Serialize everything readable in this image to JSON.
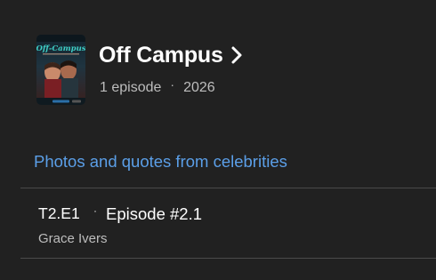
{
  "show": {
    "title": "Off Campus",
    "episodes": "1 episode",
    "separator": "·",
    "year": "2026",
    "poster_text": "Off-Campus",
    "poster_brand": "prime video"
  },
  "links": {
    "photos_quotes": "Photos and quotes from celebrities"
  },
  "episode": {
    "code": "T2.E1",
    "separator": "·",
    "title": "Episode #2.1",
    "author": "Grace Ivers"
  },
  "colors": {
    "background": "#212121",
    "link": "#5b9fe8",
    "divider": "#4a4a4a",
    "poster_title": "#3fd0c8"
  },
  "icons": {
    "title_chevron": "chevron-right-icon"
  }
}
